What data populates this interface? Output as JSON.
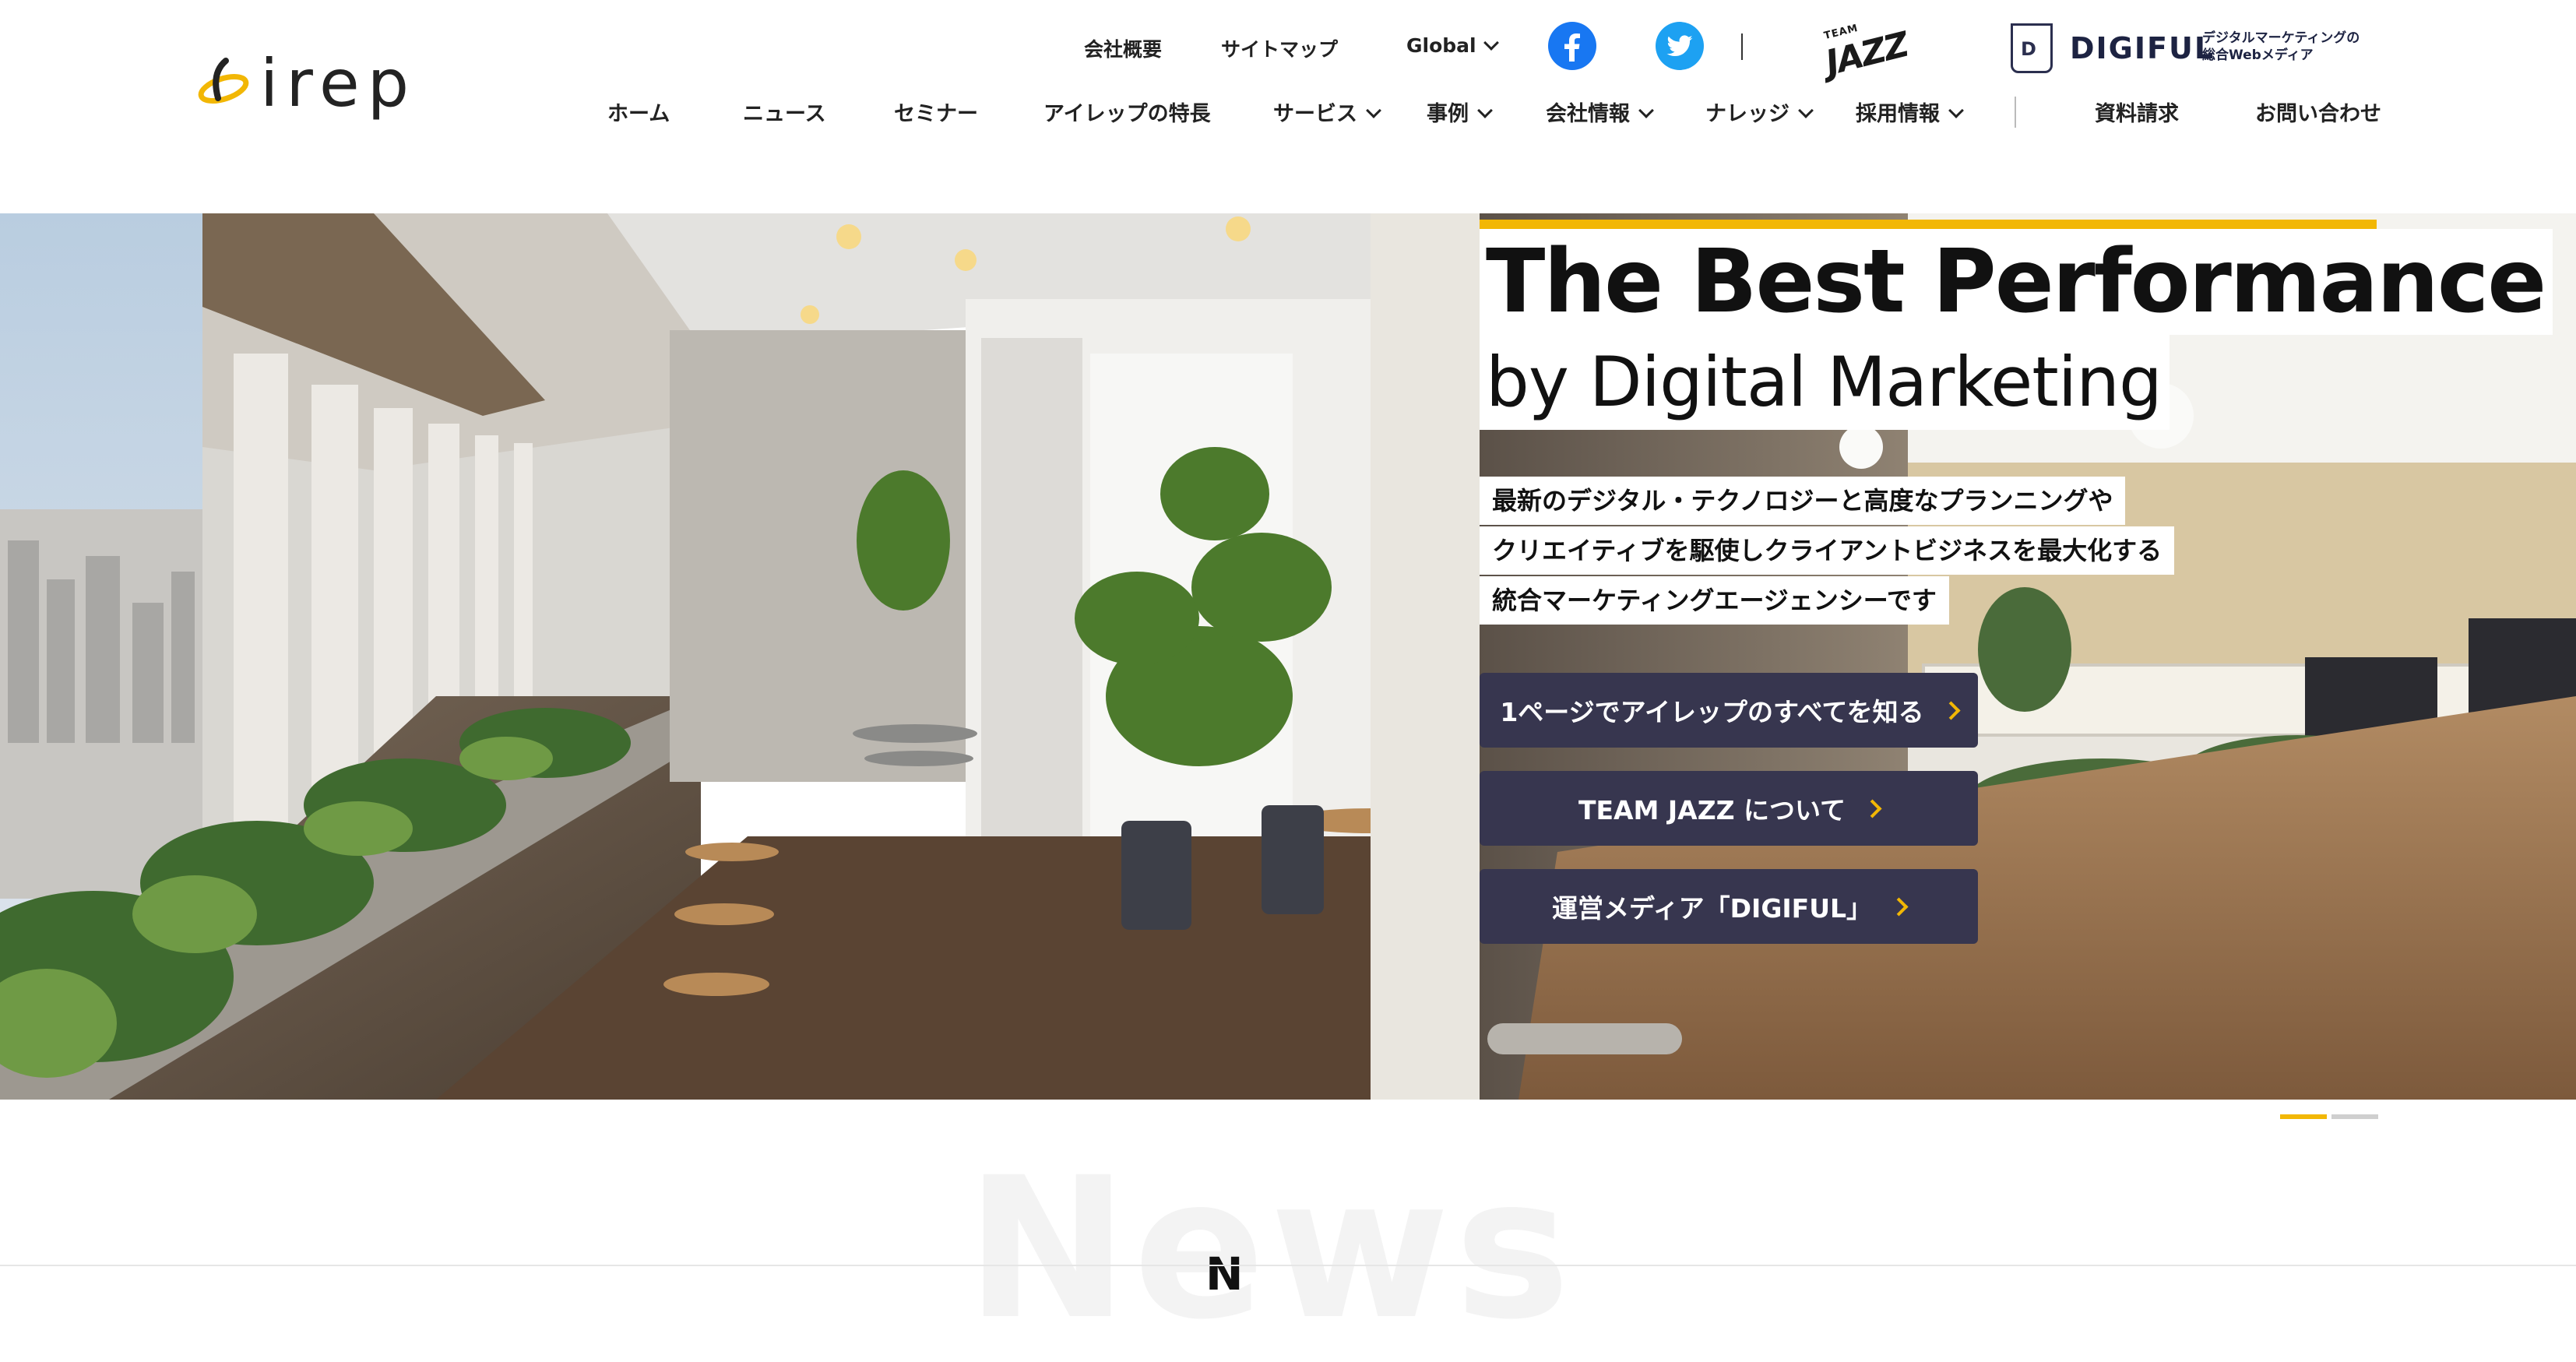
{
  "header": {
    "logo_text": "irep",
    "util_links": [
      "会社概要",
      "サイトマップ"
    ],
    "global_label": "Global",
    "team_jazz": {
      "top": "TEAM",
      "main": "JAZZ"
    },
    "digiful": {
      "badge": "D",
      "word": "DIGIFUL",
      "sub_line1": "デジタルマーケティングの",
      "sub_line2": "総合Webメディア"
    },
    "nav": [
      "ホーム",
      "ニュース",
      "セミナー",
      "アイレップの特長",
      "サービス",
      "事例",
      "会社情報",
      "ナレッジ",
      "採用情報"
    ],
    "nav_right": [
      "資料請求",
      "お問い合わせ"
    ]
  },
  "hero": {
    "headline": "The Best Performance",
    "subheadline": "by Digital Marketing",
    "lead": [
      "最新のデジタル・テクノロジーと高度なプランニングや",
      "クリエイティブを駆使しクライアントビジネスを最大化する",
      "統合マーケティングエージェンシーです"
    ],
    "cta": [
      "1ページでアイレップのすべてを知る",
      "TEAM JAZZ について",
      "運営メディア「DIGIFUL」"
    ]
  },
  "carousel": {
    "active_index": 0,
    "total": 2
  },
  "section": {
    "bg_title": "News",
    "title": "N"
  },
  "colors": {
    "accent": "#f2b705",
    "cta_bg": "#37364f",
    "facebook": "#1877f2",
    "twitter": "#1da1f2",
    "brand_navy": "#1d2342"
  },
  "icons": [
    "irep-logo-mark",
    "chevron-down-icon",
    "facebook-icon",
    "twitter-icon",
    "team-jazz-logo",
    "digiful-logo",
    "chevron-right-icon"
  ]
}
